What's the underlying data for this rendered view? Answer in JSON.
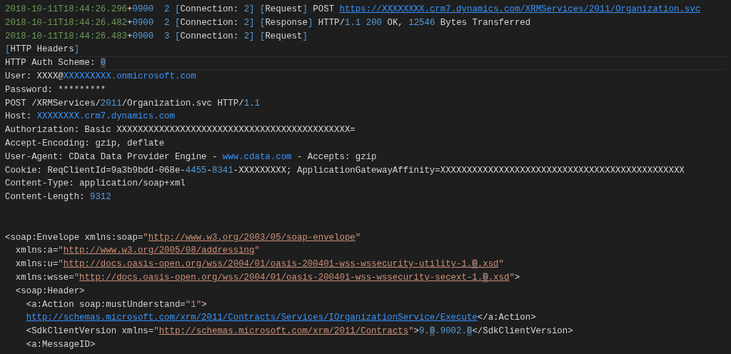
{
  "editor": {
    "lines": [
      {
        "kind": "code",
        "current": false,
        "segments": [
          {
            "kind": "date",
            "text": "2018-10-11T18:44:26.296"
          },
          {
            "kind": "text",
            "text": "+"
          },
          {
            "kind": "number",
            "text": "0900  "
          },
          {
            "kind": "number",
            "text": "2 "
          },
          {
            "kind": "bracket",
            "text": "["
          },
          {
            "kind": "text",
            "text": "Connection: "
          },
          {
            "kind": "number",
            "text": "2"
          },
          {
            "kind": "bracket",
            "text": "] "
          },
          {
            "kind": "bracket",
            "text": "["
          },
          {
            "kind": "text",
            "text": "Request"
          },
          {
            "kind": "bracket",
            "text": "]"
          },
          {
            "kind": "text",
            "text": " POST "
          },
          {
            "kind": "link",
            "text": "https://XXXXXXXX.crm7.dynamics.com/XRMServices/2011/Organization.svc"
          }
        ]
      },
      {
        "kind": "code",
        "current": false,
        "segments": [
          {
            "kind": "date",
            "text": "2018-10-11T18:44:26.482"
          },
          {
            "kind": "text",
            "text": "+"
          },
          {
            "kind": "number",
            "text": "0900  "
          },
          {
            "kind": "number",
            "text": "2 "
          },
          {
            "kind": "bracket",
            "text": "["
          },
          {
            "kind": "text",
            "text": "Connection: "
          },
          {
            "kind": "number",
            "text": "2"
          },
          {
            "kind": "bracket",
            "text": "] "
          },
          {
            "kind": "bracket",
            "text": "["
          },
          {
            "kind": "text",
            "text": "Response"
          },
          {
            "kind": "bracket",
            "text": "]"
          },
          {
            "kind": "text",
            "text": " HTTP/"
          },
          {
            "kind": "number",
            "text": "1.1 "
          },
          {
            "kind": "number",
            "text": "200"
          },
          {
            "kind": "text",
            "text": " OK, "
          },
          {
            "kind": "number",
            "text": "12546"
          },
          {
            "kind": "text",
            "text": " Bytes Transferred"
          }
        ]
      },
      {
        "kind": "code",
        "current": false,
        "segments": [
          {
            "kind": "date",
            "text": "2018-10-11T18:44:26.483"
          },
          {
            "kind": "text",
            "text": "+"
          },
          {
            "kind": "number",
            "text": "0900  "
          },
          {
            "kind": "number",
            "text": "3 "
          },
          {
            "kind": "bracket",
            "text": "["
          },
          {
            "kind": "text",
            "text": "Connection: "
          },
          {
            "kind": "number",
            "text": "2"
          },
          {
            "kind": "bracket",
            "text": "] "
          },
          {
            "kind": "bracket",
            "text": "["
          },
          {
            "kind": "text",
            "text": "Request"
          },
          {
            "kind": "bracket",
            "text": "]"
          }
        ]
      },
      {
        "kind": "code",
        "current": false,
        "segments": [
          {
            "kind": "bracket",
            "text": "["
          },
          {
            "kind": "text",
            "text": "HTTP Headers"
          },
          {
            "kind": "bracket",
            "text": "]"
          }
        ]
      },
      {
        "kind": "code",
        "current": true,
        "segments": [
          {
            "kind": "text",
            "text": "HTTP Auth Scheme: "
          },
          {
            "kind": "match",
            "text": "0"
          }
        ]
      },
      {
        "kind": "code",
        "current": false,
        "segments": [
          {
            "kind": "text",
            "text": "User: XXXX@"
          },
          {
            "kind": "host",
            "text": "XXXXXXXXX.onmicrosoft.com"
          }
        ]
      },
      {
        "kind": "code",
        "current": false,
        "segments": [
          {
            "kind": "text",
            "text": "Password: *********"
          }
        ]
      },
      {
        "kind": "code",
        "current": false,
        "segments": [
          {
            "kind": "text",
            "text": "POST /XRMServices/"
          },
          {
            "kind": "number",
            "text": "2011"
          },
          {
            "kind": "text",
            "text": "/Organization.svc HTTP/"
          },
          {
            "kind": "number",
            "text": "1.1"
          }
        ]
      },
      {
        "kind": "code",
        "current": false,
        "segments": [
          {
            "kind": "text",
            "text": "Host: "
          },
          {
            "kind": "host",
            "text": "XXXXXXXX.crm7.dynamics.com"
          }
        ]
      },
      {
        "kind": "code",
        "current": false,
        "segments": [
          {
            "kind": "text",
            "text": "Authorization: Basic XXXXXXXXXXXXXXXXXXXXXXXXXXXXXXXXXXXXXXXXXXXX="
          }
        ]
      },
      {
        "kind": "code",
        "current": false,
        "segments": [
          {
            "kind": "text",
            "text": "Accept-Encoding: gzip, deflate"
          }
        ]
      },
      {
        "kind": "code",
        "current": false,
        "segments": [
          {
            "kind": "text",
            "text": "User-Agent: CData Data Provider Engine - "
          },
          {
            "kind": "host",
            "text": "www.cdata.com"
          },
          {
            "kind": "text",
            "text": " - Accepts: gzip"
          }
        ]
      },
      {
        "kind": "code",
        "current": false,
        "segments": [
          {
            "kind": "text",
            "text": "Cookie: ReqClientId=9a3b9bdd-068e-"
          },
          {
            "kind": "number",
            "text": "4455"
          },
          {
            "kind": "text",
            "text": "-"
          },
          {
            "kind": "number",
            "text": "8341"
          },
          {
            "kind": "text",
            "text": "-XXXXXXXXX; ApplicationGatewayAffinity=XXXXXXXXXXXXXXXXXXXXXXXXXXXXXXXXXXXXXXXXXXXXXX"
          }
        ]
      },
      {
        "kind": "code",
        "current": false,
        "segments": [
          {
            "kind": "text",
            "text": "Content-Type: application/soap+xml"
          }
        ]
      },
      {
        "kind": "code",
        "current": false,
        "segments": [
          {
            "kind": "text",
            "text": "Content-Length: "
          },
          {
            "kind": "number",
            "text": "9312"
          }
        ]
      },
      {
        "kind": "blank"
      },
      {
        "kind": "blank"
      },
      {
        "kind": "code",
        "current": false,
        "segments": [
          {
            "kind": "text",
            "text": "<soap:Envelope xmlns:soap="
          },
          {
            "kind": "string",
            "text": "\""
          },
          {
            "kind": "string-link",
            "text": "http://www.w3.org/2003/05/soap-envelope"
          },
          {
            "kind": "string",
            "text": "\""
          }
        ]
      },
      {
        "kind": "code",
        "current": false,
        "segments": [
          {
            "kind": "text",
            "text": "  xmlns:a="
          },
          {
            "kind": "string",
            "text": "\""
          },
          {
            "kind": "string-link",
            "text": "http://www.w3.org/2005/08/addressing"
          },
          {
            "kind": "string",
            "text": "\""
          }
        ]
      },
      {
        "kind": "code",
        "current": false,
        "segments": [
          {
            "kind": "text",
            "text": "  xmlns:u="
          },
          {
            "kind": "string",
            "text": "\""
          },
          {
            "kind": "string-link",
            "text": "http://docs.oasis-open.org/wss/2004/01/oasis-200401-wss-wssecurity-utility-1."
          },
          {
            "kind": "string-link-match",
            "text": "0"
          },
          {
            "kind": "string-link",
            "text": ".xsd"
          },
          {
            "kind": "string",
            "text": "\""
          }
        ]
      },
      {
        "kind": "code",
        "current": false,
        "segments": [
          {
            "kind": "text",
            "text": "  xmlns:wsse="
          },
          {
            "kind": "string",
            "text": "\""
          },
          {
            "kind": "string-link",
            "text": "http://docs.oasis-open.org/wss/2004/01/oasis-200401-wss-wssecurity-secext-1."
          },
          {
            "kind": "string-link-match",
            "text": "0"
          },
          {
            "kind": "string-link",
            "text": ".xsd"
          },
          {
            "kind": "string",
            "text": "\""
          },
          {
            "kind": "text",
            "text": ">"
          }
        ]
      },
      {
        "kind": "code",
        "current": false,
        "segments": [
          {
            "kind": "text",
            "text": "  <soap:Header>"
          }
        ]
      },
      {
        "kind": "code",
        "current": false,
        "segments": [
          {
            "kind": "text",
            "text": "    <a:Action soap:mustUnderstand="
          },
          {
            "kind": "string",
            "text": "\"1\""
          },
          {
            "kind": "text",
            "text": ">"
          }
        ]
      },
      {
        "kind": "code",
        "current": false,
        "segments": [
          {
            "kind": "link",
            "text": "    http://schemas.microsoft.com/xrm/2011/Contracts/Services/IOrganizationService/Execute"
          },
          {
            "kind": "text",
            "text": "</a:Action>"
          }
        ]
      },
      {
        "kind": "code",
        "current": false,
        "segments": [
          {
            "kind": "text",
            "text": "    <SdkClientVersion xmlns="
          },
          {
            "kind": "string",
            "text": "\""
          },
          {
            "kind": "string-link",
            "text": "http://schemas.microsoft.com/xrm/2011/Contracts"
          },
          {
            "kind": "string",
            "text": "\""
          },
          {
            "kind": "text",
            "text": ">"
          },
          {
            "kind": "number",
            "text": "9."
          },
          {
            "kind": "match",
            "text": "0"
          },
          {
            "kind": "number",
            "text": ".9002."
          },
          {
            "kind": "match",
            "text": "0"
          },
          {
            "kind": "text",
            "text": "</SdkClientVersion>"
          }
        ]
      },
      {
        "kind": "code",
        "current": false,
        "segments": [
          {
            "kind": "text",
            "text": "    <a:MessageID>"
          }
        ]
      }
    ]
  }
}
